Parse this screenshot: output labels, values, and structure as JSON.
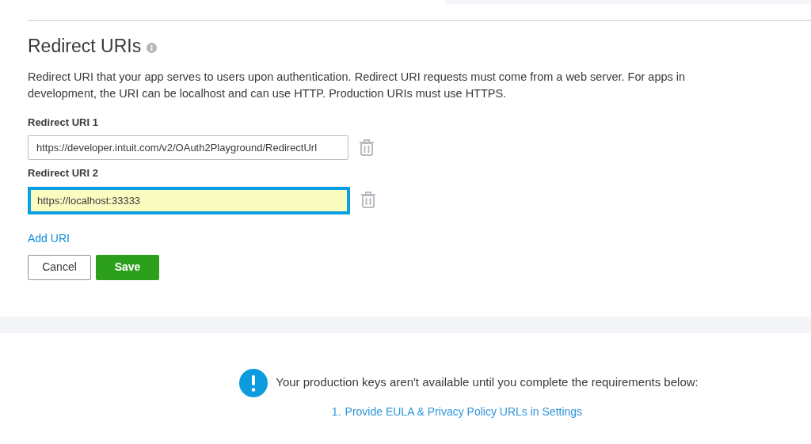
{
  "section": {
    "title": "Redirect URIs",
    "description": "Redirect URI that your app serves to users upon authentication. Redirect URI requests must come from a web server. For apps in development, the URI can be localhost and can use HTTP. Production URIs must use HTTPS."
  },
  "redirect_uris": [
    {
      "label": "Redirect URI 1",
      "value": "https://developer.intuit.com/v2/OAuth2Playground/RedirectUrl",
      "highlighted": false
    },
    {
      "label": "Redirect URI 2",
      "value": "https://localhost:33333",
      "highlighted": true
    }
  ],
  "add_link": "Add URI",
  "buttons": [
    {
      "label": "Cancel",
      "kind": "secondary"
    },
    {
      "label": "Save",
      "kind": "primary"
    }
  ],
  "notice": {
    "message": "Your production keys aren't available until you complete the requirements below:",
    "requirements": [
      {
        "number": "1.",
        "text": "Provide EULA & Privacy Policy URLs in Settings"
      }
    ]
  }
}
